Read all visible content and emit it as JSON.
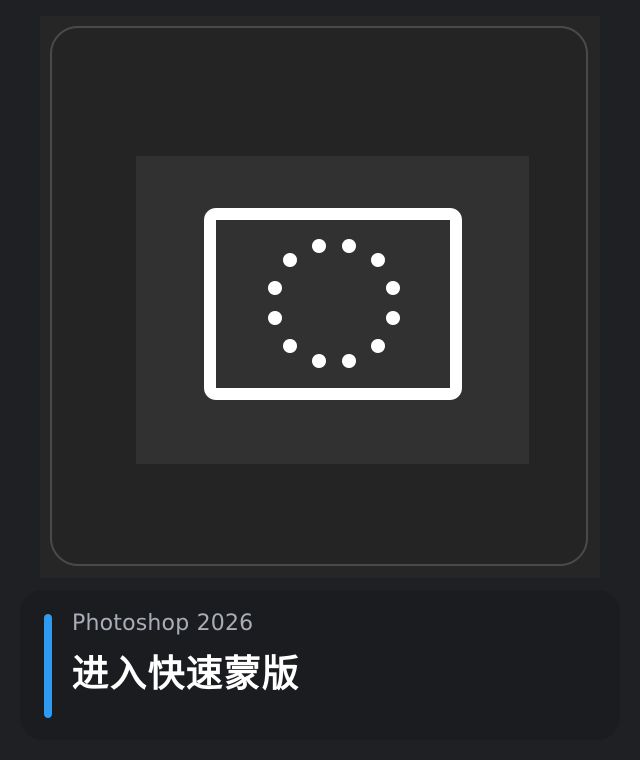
{
  "caption": {
    "app_name": "Photoshop 2026",
    "action_title": "进入快速蒙版"
  },
  "icon": {
    "name": "quick-mask-icon",
    "foreground": "#ffffff",
    "background": "#313131"
  },
  "colors": {
    "accent": "#2f9bf0",
    "page_background": "#1f2023",
    "caption_background": "#1b1c1f",
    "subtitle_text": "#a9adb5",
    "title_text": "#ffffff"
  }
}
